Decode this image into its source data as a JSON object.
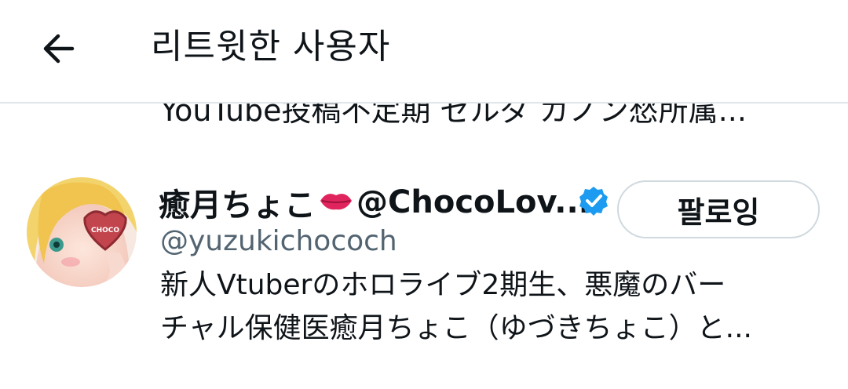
{
  "header": {
    "title": "리트윗한 사용자",
    "back_icon": "arrow-left-icon"
  },
  "previous_user": {
    "bio_tail": "YouTube投稿不定期 ゼルダ カノン愁所属..."
  },
  "user": {
    "display_name": "癒月ちょこ",
    "display_name_suffix": "@ChocoLov...",
    "emoji": "lips-kiss-icon",
    "verified_icon": "verified-badge-icon",
    "handle": "@yuzukichococh",
    "bio_line1": "新人Vtuberのホロライブ2期生、悪魔のバー",
    "bio_line2": "チャル保健医癒月ちょこ（ゆづきちょこ）と...",
    "avatar_label": "CHOCO",
    "follow_label": "팔로잉"
  },
  "colors": {
    "verified": "#1d9bf0",
    "handle_gray": "#536471",
    "divider": "#e1e6ea",
    "lips_red": "#e0245e"
  }
}
